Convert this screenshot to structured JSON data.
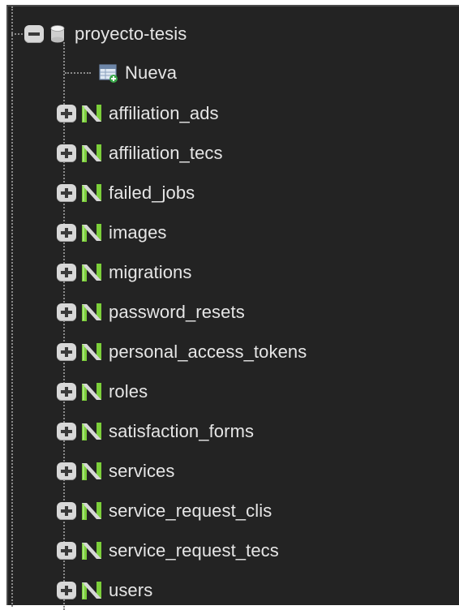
{
  "database": {
    "name": "proyecto-tesis",
    "icon": "database-icon",
    "expanded": true
  },
  "new_item": {
    "label": "Nueva",
    "icon": "new-table-icon"
  },
  "tables": [
    {
      "name": "affiliation_ads"
    },
    {
      "name": "affiliation_tecs"
    },
    {
      "name": "failed_jobs"
    },
    {
      "name": "images"
    },
    {
      "name": "migrations"
    },
    {
      "name": "password_resets"
    },
    {
      "name": "personal_access_tokens"
    },
    {
      "name": "roles"
    },
    {
      "name": "satisfaction_forms"
    },
    {
      "name": "services"
    },
    {
      "name": "service_request_clis"
    },
    {
      "name": "service_request_tecs"
    },
    {
      "name": "users"
    }
  ],
  "colors": {
    "background": "#232323",
    "text": "#e6e6e6",
    "toggle": "#d8d8d8",
    "table_icon_green": "#7ccf3a"
  }
}
